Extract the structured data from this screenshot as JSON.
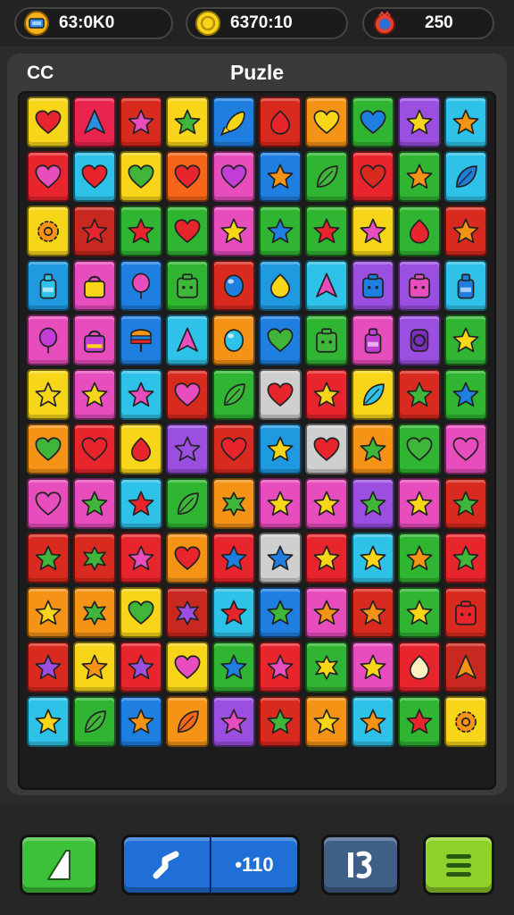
{
  "hud": {
    "left_value": "63:0K0",
    "center_value": "6370:10",
    "right_value": "250"
  },
  "panel": {
    "left_label": "CC",
    "title": "Puzle"
  },
  "bottom": {
    "count_label": "•110"
  },
  "board": {
    "rows": [
      [
        [
          "#f7d61a",
          "heart",
          "#e8242d"
        ],
        [
          "#e8244f",
          "arrow",
          "#2a8fe0"
        ],
        [
          "#d92a1f",
          "star",
          "#e84dbd"
        ],
        [
          "#f7d61a",
          "star",
          "#3fb53a"
        ],
        [
          "#1f7fe0",
          "rocket",
          "#f7d61a"
        ],
        [
          "#d92a1f",
          "drop",
          "#e8242d"
        ],
        [
          "#f59316",
          "heart",
          "#f7d61a"
        ],
        [
          "#2fb531",
          "heart",
          "#1f7fe0"
        ],
        [
          "#9a4fe0",
          "star",
          "#f7d61a"
        ],
        [
          "#2fc2e8",
          "star",
          "#f59316"
        ]
      ],
      [
        [
          "#e8242d",
          "heart",
          "#e84dbd"
        ],
        [
          "#2fc2e8",
          "heart",
          "#e8242d"
        ],
        [
          "#f7d61a",
          "heart",
          "#3fb53a"
        ],
        [
          "#f5661a",
          "heart",
          "#e8242d"
        ],
        [
          "#e84dbd",
          "heart",
          "#c23cd6"
        ],
        [
          "#1f7fe0",
          "star",
          "#f59316"
        ],
        [
          "#2fb531",
          "leaf",
          "#3fb53a"
        ],
        [
          "#e8242d",
          "heart",
          "#d92a1f"
        ],
        [
          "#2fb531",
          "star",
          "#f59316"
        ],
        [
          "#2fc2e8",
          "leaf",
          "#1f7fe0"
        ]
      ],
      [
        [
          "#f7d61a",
          "gear",
          "#f59316"
        ],
        [
          "#c8281f",
          "star",
          "#e8242d"
        ],
        [
          "#2fb531",
          "star",
          "#e8242d"
        ],
        [
          "#2fb531",
          "heart",
          "#e8242d"
        ],
        [
          "#e84dbd",
          "star",
          "#f7d61a"
        ],
        [
          "#2fb531",
          "star",
          "#1f7fe0"
        ],
        [
          "#2fb531",
          "star",
          "#e8242d"
        ],
        [
          "#f7d61a",
          "star",
          "#e84dbd"
        ],
        [
          "#2fb531",
          "drop",
          "#e8242d"
        ],
        [
          "#d92a1f",
          "star",
          "#f59316"
        ]
      ],
      [
        [
          "#1f9ae0",
          "bottle",
          "#2fc2e8"
        ],
        [
          "#e84dbd",
          "bag",
          "#f7d61a"
        ],
        [
          "#1f7fe0",
          "balloon",
          "#e84dbd"
        ],
        [
          "#2fb531",
          "box",
          "#3fb53a"
        ],
        [
          "#d92a1f",
          "orb",
          "#1f7fe0"
        ],
        [
          "#1f9ae0",
          "drop",
          "#f7d61a"
        ],
        [
          "#2fc2e8",
          "arrow",
          "#e84dbd"
        ],
        [
          "#9a4fe0",
          "box",
          "#1f7fe0"
        ],
        [
          "#9a4fe0",
          "box",
          "#e84dbd"
        ],
        [
          "#2fc2e8",
          "bottle",
          "#1f7fe0"
        ]
      ],
      [
        [
          "#e84dbd",
          "balloon",
          "#c23cd6"
        ],
        [
          "#e84dbd",
          "bag",
          "#c23cd6"
        ],
        [
          "#1f7fe0",
          "stack",
          "#f59316"
        ],
        [
          "#2fc2e8",
          "arrow",
          "#e84dbd"
        ],
        [
          "#f59316",
          "orb",
          "#2fc2e8"
        ],
        [
          "#1f7fe0",
          "heart",
          "#3fb53a"
        ],
        [
          "#2fb531",
          "box",
          "#3fb53a"
        ],
        [
          "#e84dbd",
          "bottle",
          "#c23cd6"
        ],
        [
          "#9a4fe0",
          "ring",
          "#7a2fbd"
        ],
        [
          "#2fb531",
          "star",
          "#f7d61a"
        ]
      ],
      [
        [
          "#f7d61a",
          "star",
          "#f7d61a"
        ],
        [
          "#e84dbd",
          "star",
          "#f7d61a"
        ],
        [
          "#2fc2e8",
          "star",
          "#e84dbd"
        ],
        [
          "#d92a1f",
          "heart",
          "#e84dbd"
        ],
        [
          "#2fb531",
          "leaf",
          "#3fb53a"
        ],
        [
          "#cfcfcf",
          "heart",
          "#e8242d"
        ],
        [
          "#e8242d",
          "star",
          "#f7d61a"
        ],
        [
          "#f7d61a",
          "leaf",
          "#2fc2e8"
        ],
        [
          "#d92a1f",
          "star",
          "#3fb53a"
        ],
        [
          "#2fb531",
          "star",
          "#1f7fe0"
        ]
      ],
      [
        [
          "#f59316",
          "heart",
          "#3fb53a"
        ],
        [
          "#e8242d",
          "heart",
          "#e8242d"
        ],
        [
          "#f7d61a",
          "drop",
          "#e8242d"
        ],
        [
          "#9a4fe0",
          "star",
          "#9a4fe0"
        ],
        [
          "#d92a1f",
          "heart",
          "#e8242d"
        ],
        [
          "#1f9ae0",
          "star",
          "#f7d61a"
        ],
        [
          "#cfcfcf",
          "heart",
          "#e8242d"
        ],
        [
          "#f59316",
          "star",
          "#3fb53a"
        ],
        [
          "#2fb531",
          "heart",
          "#3fb53a"
        ],
        [
          "#e84dbd",
          "heart",
          "#e84dbd"
        ]
      ],
      [
        [
          "#e84dbd",
          "heart",
          "#e84dbd"
        ],
        [
          "#e84dbd",
          "star",
          "#3fb53a"
        ],
        [
          "#2fc2e8",
          "star",
          "#e8242d"
        ],
        [
          "#2fb531",
          "leaf",
          "#3fb53a"
        ],
        [
          "#f59316",
          "splat",
          "#3fb53a"
        ],
        [
          "#e84dbd",
          "star",
          "#f7d61a"
        ],
        [
          "#e84dbd",
          "star",
          "#f7d61a"
        ],
        [
          "#9a4fe0",
          "star",
          "#3fb53a"
        ],
        [
          "#e84dbd",
          "star",
          "#f7d61a"
        ],
        [
          "#d92a1f",
          "star",
          "#3fb53a"
        ]
      ],
      [
        [
          "#d92a1f",
          "star",
          "#3fb53a"
        ],
        [
          "#d92a1f",
          "splat",
          "#3fb53a"
        ],
        [
          "#e8242d",
          "star",
          "#e84dbd"
        ],
        [
          "#f59316",
          "heart",
          "#e8242d"
        ],
        [
          "#e8242d",
          "star",
          "#1f7fe0"
        ],
        [
          "#cfcfcf",
          "star",
          "#1f7fe0"
        ],
        [
          "#e8242d",
          "star",
          "#f7d61a"
        ],
        [
          "#2fc2e8",
          "star",
          "#f7d61a"
        ],
        [
          "#2fb531",
          "star",
          "#f59316"
        ],
        [
          "#e8242d",
          "star",
          "#3fb53a"
        ]
      ],
      [
        [
          "#f59316",
          "star",
          "#f7d61a"
        ],
        [
          "#f59316",
          "splat",
          "#3fb53a"
        ],
        [
          "#f7d61a",
          "heart",
          "#3fb53a"
        ],
        [
          "#c8281f",
          "splat",
          "#9a4fe0"
        ],
        [
          "#2fc2e8",
          "star",
          "#e8242d"
        ],
        [
          "#1f7fe0",
          "star",
          "#3fb53a"
        ],
        [
          "#e84dbd",
          "star",
          "#f59316"
        ],
        [
          "#d92a1f",
          "star",
          "#f59316"
        ],
        [
          "#2fb531",
          "star",
          "#f7d61a"
        ],
        [
          "#d92a1f",
          "box",
          "#e8242d"
        ]
      ],
      [
        [
          "#d92a1f",
          "star",
          "#9a4fe0"
        ],
        [
          "#f7d61a",
          "star",
          "#f59316"
        ],
        [
          "#e8242d",
          "star",
          "#9a4fe0"
        ],
        [
          "#f7d61a",
          "heart",
          "#e84dbd"
        ],
        [
          "#2fb531",
          "star",
          "#1f7fe0"
        ],
        [
          "#e8242d",
          "star",
          "#e84dbd"
        ],
        [
          "#2fb531",
          "splat",
          "#f7d61a"
        ],
        [
          "#e84dbd",
          "star",
          "#f7d61a"
        ],
        [
          "#e8242d",
          "drop",
          "#fff0c0"
        ],
        [
          "#c8281f",
          "arrow",
          "#f59316"
        ]
      ],
      [
        [
          "#2fc2e8",
          "star",
          "#f7d61a"
        ],
        [
          "#2fb531",
          "leaf",
          "#3fb53a"
        ],
        [
          "#1f7fe0",
          "star",
          "#f59316"
        ],
        [
          "#f59316",
          "leaf",
          "#f5661a"
        ],
        [
          "#9a4fe0",
          "star",
          "#e84dbd"
        ],
        [
          "#d92a1f",
          "star",
          "#3fb53a"
        ],
        [
          "#f59316",
          "star",
          "#f7d61a"
        ],
        [
          "#2fc2e8",
          "star",
          "#f59316"
        ],
        [
          "#2fb531",
          "star",
          "#e8242d"
        ],
        [
          "#f7d61a",
          "gear",
          "#f59316"
        ]
      ]
    ]
  }
}
